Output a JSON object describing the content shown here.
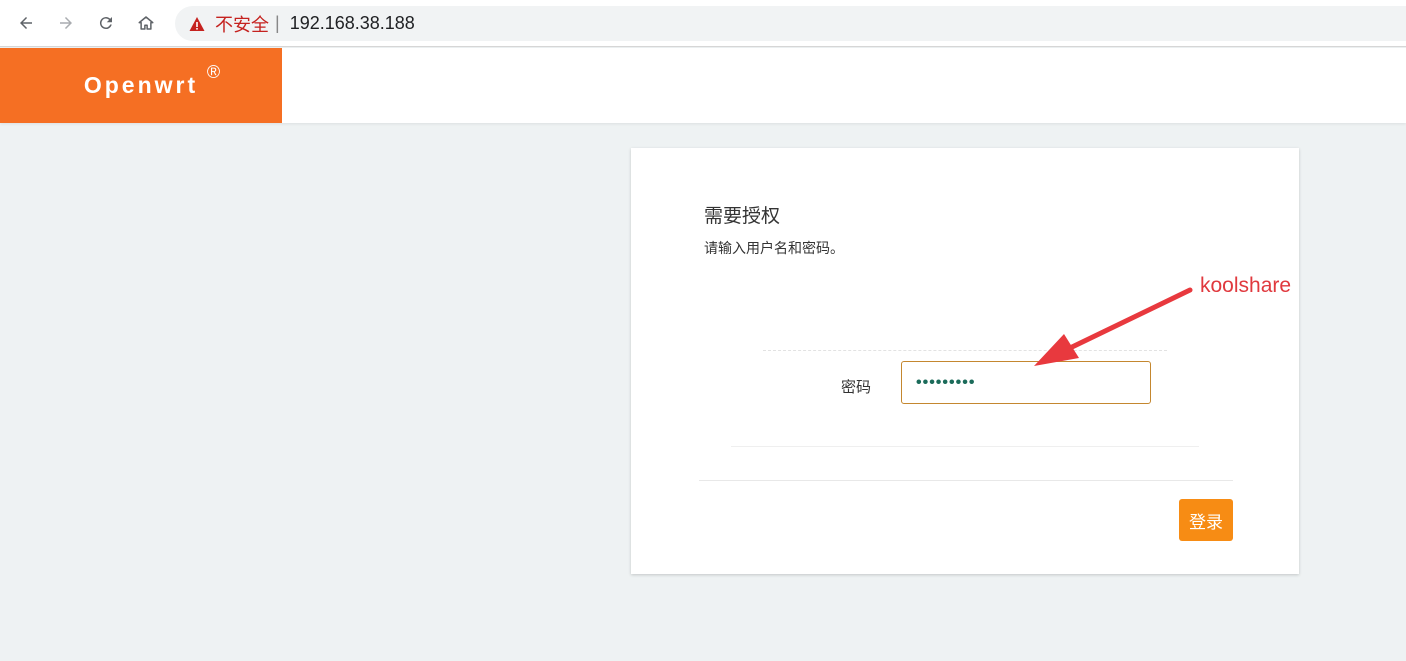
{
  "browser": {
    "back_icon": "back-arrow-icon",
    "forward_icon": "forward-arrow-icon",
    "reload_icon": "reload-icon",
    "home_icon": "home-icon",
    "security_warning_icon": "warning-triangle-icon",
    "security_label": "不安全",
    "separator": "|",
    "url": "192.168.38.188"
  },
  "header": {
    "brand": "Openwrt",
    "brand_mark": "®",
    "brand_color": "#f56f23"
  },
  "login": {
    "title": "需要授权",
    "description": "请输入用户名和密码。",
    "password_label": "密码",
    "password_value": "•••••••••",
    "submit_label": "登录",
    "submit_color": "#f78c14"
  },
  "annotation": {
    "text": "koolshare",
    "color": "#e0393e"
  }
}
